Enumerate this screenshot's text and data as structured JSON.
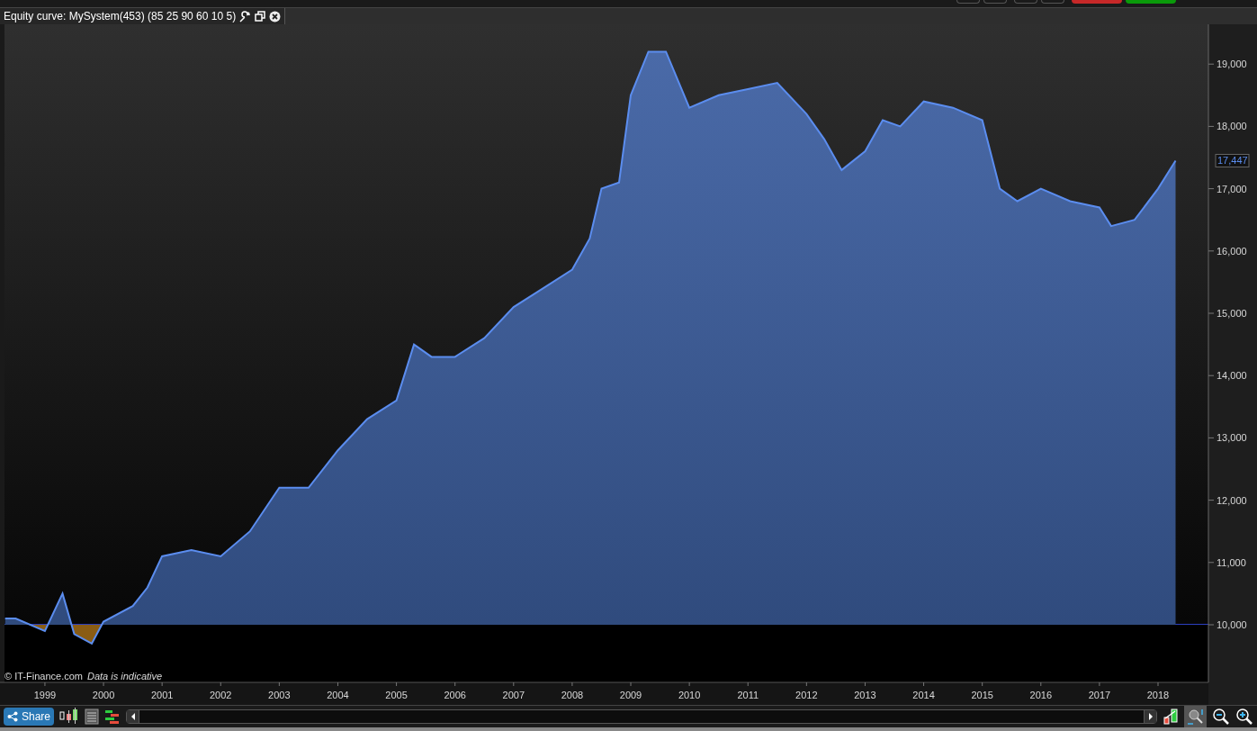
{
  "window": {
    "title": "Equity curve: MySystem(453) (85 25 90 60 10 5)"
  },
  "chart": {
    "chart_data": {
      "type": "area",
      "x": [
        1998.32,
        1998.5,
        1999.0,
        1999.3,
        1999.5,
        1999.8,
        2000.0,
        2000.5,
        2000.75,
        2001.0,
        2001.5,
        2002.0,
        2002.5,
        2003.0,
        2003.5,
        2004.0,
        2004.5,
        2005.0,
        2005.3,
        2005.6,
        2006.0,
        2006.5,
        2007.0,
        2007.5,
        2008.0,
        2008.3,
        2008.5,
        2008.8,
        2009.0,
        2009.3,
        2009.6,
        2010.0,
        2010.5,
        2011.0,
        2011.5,
        2012.0,
        2012.3,
        2012.6,
        2013.0,
        2013.3,
        2013.6,
        2014.0,
        2014.5,
        2015.0,
        2015.3,
        2015.6,
        2016.0,
        2016.5,
        2017.0,
        2017.2,
        2017.6,
        2018.0,
        2018.3
      ],
      "series": [
        {
          "color": "#5b8def",
          "values": [
            10100,
            10100,
            9900,
            10500,
            9850,
            9700,
            10050,
            10300,
            10600,
            11100,
            11200,
            11100,
            11500,
            12200,
            12200,
            12800,
            13300,
            13600,
            14500,
            14300,
            14300,
            14600,
            15100,
            15400,
            15700,
            16200,
            17000,
            17100,
            18500,
            19200,
            19200,
            18300,
            18500,
            18600,
            18700,
            18200,
            17800,
            17300,
            17600,
            18100,
            18000,
            18400,
            18300,
            18100,
            17000,
            16800,
            17000,
            16800,
            16700,
            16400,
            16500,
            17000,
            17450
          ]
        }
      ],
      "xlim": [
        1998.31,
        2018.86
      ],
      "ylim": [
        9075,
        19639
      ],
      "xticks": [
        {
          "value": 1999,
          "label": "1999"
        },
        {
          "value": 2000,
          "label": "2000"
        },
        {
          "value": 2001,
          "label": "2001"
        },
        {
          "value": 2002,
          "label": "2002"
        },
        {
          "value": 2003,
          "label": "2003"
        },
        {
          "value": 2004,
          "label": "2004"
        },
        {
          "value": 2005,
          "label": "2005"
        },
        {
          "value": 2006,
          "label": "2006"
        },
        {
          "value": 2007,
          "label": "2007"
        },
        {
          "value": 2008,
          "label": "2008"
        },
        {
          "value": 2009,
          "label": "2009"
        },
        {
          "value": 2010,
          "label": "2010"
        },
        {
          "value": 2011,
          "label": "2011"
        },
        {
          "value": 2012,
          "label": "2012"
        },
        {
          "value": 2013,
          "label": "2013"
        },
        {
          "value": 2014,
          "label": "2014"
        },
        {
          "value": 2015,
          "label": "2015"
        },
        {
          "value": 2016,
          "label": "2016"
        },
        {
          "value": 2017,
          "label": "2017"
        },
        {
          "value": 2018,
          "label": "2018"
        }
      ],
      "yticks": [
        {
          "value": 10000,
          "label": "10,000"
        },
        {
          "value": 11000,
          "label": "11,000"
        },
        {
          "value": 12000,
          "label": "12,000"
        },
        {
          "value": 13000,
          "label": "13,000"
        },
        {
          "value": 14000,
          "label": "14,000"
        },
        {
          "value": 15000,
          "label": "15,000"
        },
        {
          "value": 16000,
          "label": "16,000"
        },
        {
          "value": 17000,
          "label": "17,000"
        },
        {
          "value": 18000,
          "label": "18,000"
        },
        {
          "value": 19000,
          "label": "19,000"
        }
      ],
      "annotations": [
        "17,447"
      ]
    },
    "copyright": "© IT-Finance.com",
    "note": "Data is indicative"
  },
  "toolbar": {
    "share_button": "Share"
  }
}
